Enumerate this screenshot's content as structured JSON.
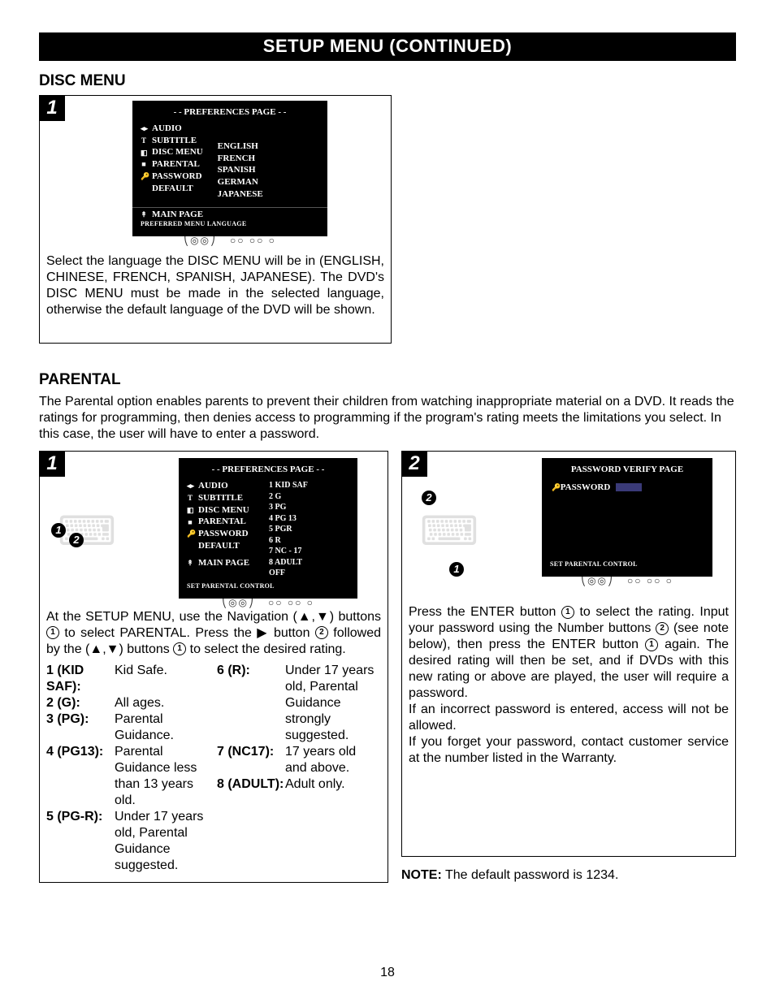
{
  "banner": "SETUP MENU (CONTINUED)",
  "disc": {
    "heading": "DISC MENU",
    "step": "1",
    "tv": {
      "title": "- - PREFERENCES PAGE - -",
      "left": [
        "AUDIO",
        "SUBTITLE",
        "DISC MENU",
        "PARENTAL",
        "PASSWORD",
        "DEFAULT"
      ],
      "right": [
        "ENGLISH",
        "FRENCH",
        "SPANISH",
        "GERMAN",
        "JAPANESE"
      ],
      "main": "MAIN PAGE",
      "sub": "PREFERRED MENU LANGUAGE"
    },
    "text": "Select the language the DISC MENU will be in (ENGLISH, CHINESE, FRENCH, SPANISH, JAPANESE). The DVD's DISC MENU must be made in the selected language, otherwise the default language of the DVD will be shown."
  },
  "parental": {
    "heading": "PARENTAL",
    "intro": "The Parental option enables parents to prevent their children from watching inappropriate material on a DVD. It reads the ratings for programming, then denies access to programming if the program's rating meets the limitations you select. In this case, the user will have to enter a password.",
    "step1": {
      "num": "1",
      "tv": {
        "title": "- - PREFERENCES PAGE - -",
        "left": [
          "AUDIO",
          "SUBTITLE",
          "DISC MENU",
          "PARENTAL",
          "PASSWORD",
          "DEFAULT"
        ],
        "right": [
          "1  KID SAF",
          "2  G",
          "3  PG",
          "4  PG 13",
          "5  PGR",
          "6  R",
          "7  NC - 17",
          "8  ADULT",
          "OFF"
        ],
        "main": "MAIN PAGE",
        "sub": "SET PARENTAL CONTROL"
      },
      "text_a": "At the SETUP MENU, use the Navigation (▲,▼) buttons ",
      "text_b": " to select PARENTAL. Press the ▶ button ",
      "text_c": " followed by the (▲,▼) buttons ",
      "text_d": " to select the desired rating.",
      "ratings_left": [
        {
          "k": "1 (KID SAF):",
          "v": "Kid Safe."
        },
        {
          "k": "2 (G):",
          "v": "All ages."
        },
        {
          "k": "3 (PG):",
          "v": "Parental Guidance."
        },
        {
          "k": "4 (PG13):",
          "v": "Parental Guidance less than 13 years old."
        },
        {
          "k": "5 (PG-R):",
          "v": "Under 17 years old, Parental Guidance suggested."
        }
      ],
      "ratings_right": [
        {
          "k": "6 (R):",
          "v": "Under 17 years old, Parental Guidance strongly suggested."
        },
        {
          "k": "7 (NC17):",
          "v": "17 years old and above."
        },
        {
          "k": "8 (ADULT):",
          "v": "Adult only."
        }
      ]
    },
    "step2": {
      "num": "2",
      "tv": {
        "title": "PASSWORD VERIFY PAGE",
        "pw": "PASSWORD",
        "sub": "SET PARENTAL CONTROL"
      },
      "text_a": "Press the ENTER button ",
      "text_b": " to select the rating. Input your password using the Number buttons ",
      "text_c": " (see note below), then press the ENTER button ",
      "text_d": " again. The desired rating will then be set, and if DVDs with this new rating or above are played, the user will require a password.",
      "text_e": "If an incorrect password is entered, access will not be allowed.",
      "text_f": "If you forget your password, contact customer service at the number listed in the Warranty."
    },
    "note_label": "NOTE:",
    "note_text": " The default password is 1234.",
    "chart_data": {
      "type": "table",
      "title": "Parental Rating Levels",
      "rows": [
        {
          "code": "1",
          "label": "KID SAF",
          "desc": "Kid Safe."
        },
        {
          "code": "2",
          "label": "G",
          "desc": "All ages."
        },
        {
          "code": "3",
          "label": "PG",
          "desc": "Parental Guidance."
        },
        {
          "code": "4",
          "label": "PG 13",
          "desc": "Parental Guidance less than 13 years old."
        },
        {
          "code": "5",
          "label": "PG-R / PGR",
          "desc": "Under 17 years old, Parental Guidance suggested."
        },
        {
          "code": "6",
          "label": "R",
          "desc": "Under 17 years old, Parental Guidance strongly suggested."
        },
        {
          "code": "7",
          "label": "NC-17",
          "desc": "17 years old and above."
        },
        {
          "code": "8",
          "label": "ADULT",
          "desc": "Adult only."
        },
        {
          "code": "",
          "label": "OFF",
          "desc": ""
        }
      ]
    }
  },
  "page_number": "18"
}
